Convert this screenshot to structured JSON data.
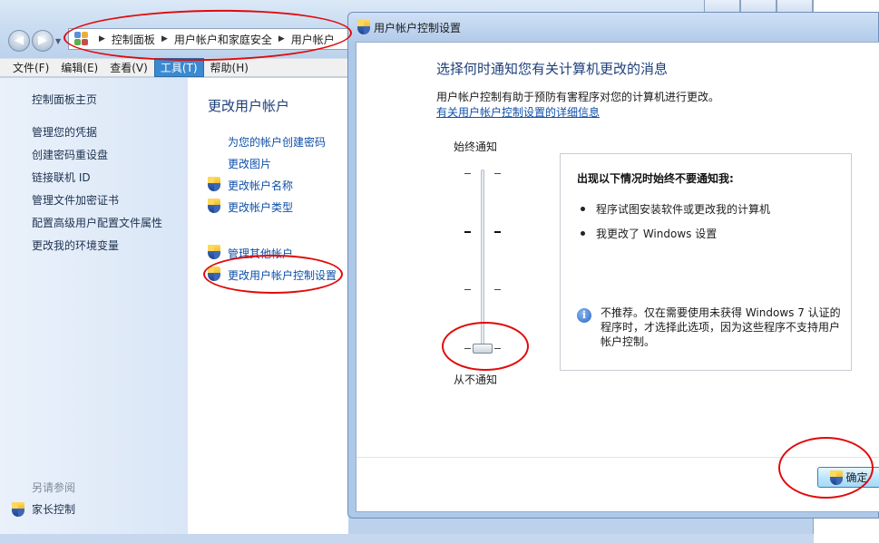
{
  "control_panel": {
    "breadcrumb": [
      "控制面板",
      "用户帐户和家庭安全",
      "用户帐户"
    ],
    "menu": [
      {
        "label": "文件(F)"
      },
      {
        "label": "编辑(E)"
      },
      {
        "label": "查看(V)"
      },
      {
        "label": "工具(T)"
      },
      {
        "label": "帮助(H)"
      }
    ],
    "sidebar": {
      "items": [
        {
          "label": "控制面板主页"
        },
        {
          "label": "管理您的凭据"
        },
        {
          "label": "创建密码重设盘"
        },
        {
          "label": "链接联机 ID"
        },
        {
          "label": "管理文件加密证书"
        },
        {
          "label": "配置高级用户配置文件属性"
        },
        {
          "label": "更改我的环境变量"
        }
      ],
      "see_also": "另请参阅",
      "family_control": "家长控制"
    },
    "main": {
      "title": "更改用户帐户",
      "links": [
        {
          "label": "为您的帐户创建密码"
        },
        {
          "label": "更改图片"
        },
        {
          "label": "更改帐户名称"
        },
        {
          "label": "更改帐户类型"
        },
        {
          "label": "管理其他帐户"
        },
        {
          "label": "更改用户帐户控制设置"
        }
      ]
    }
  },
  "uac_dialog": {
    "title": "用户帐户控制设置",
    "heading": "选择何时通知您有关计算机更改的消息",
    "description": "用户帐户控制有助于预防有害程序对您的计算机进行更改。",
    "more_info_link": "有关用户帐户控制设置的详细信息",
    "slider": {
      "top_label": "始终通知",
      "bottom_label": "从不通知",
      "levels": 4,
      "selected_level": 1
    },
    "info": {
      "heading": "出现以下情况时始终不要通知我:",
      "bullets": [
        "程序试图安装软件或更改我的计算机",
        "我更改了 Windows 设置"
      ],
      "note": "不推荐。仅在需要使用未获得 Windows 7 认证的程序时，才选择此选项，因为这些程序不支持用户帐户控制。"
    },
    "ok_button": "确定"
  },
  "colors": {
    "annotation": "#e10a0a",
    "link": "#0e4fa8",
    "heading": "#1e3f7a"
  }
}
